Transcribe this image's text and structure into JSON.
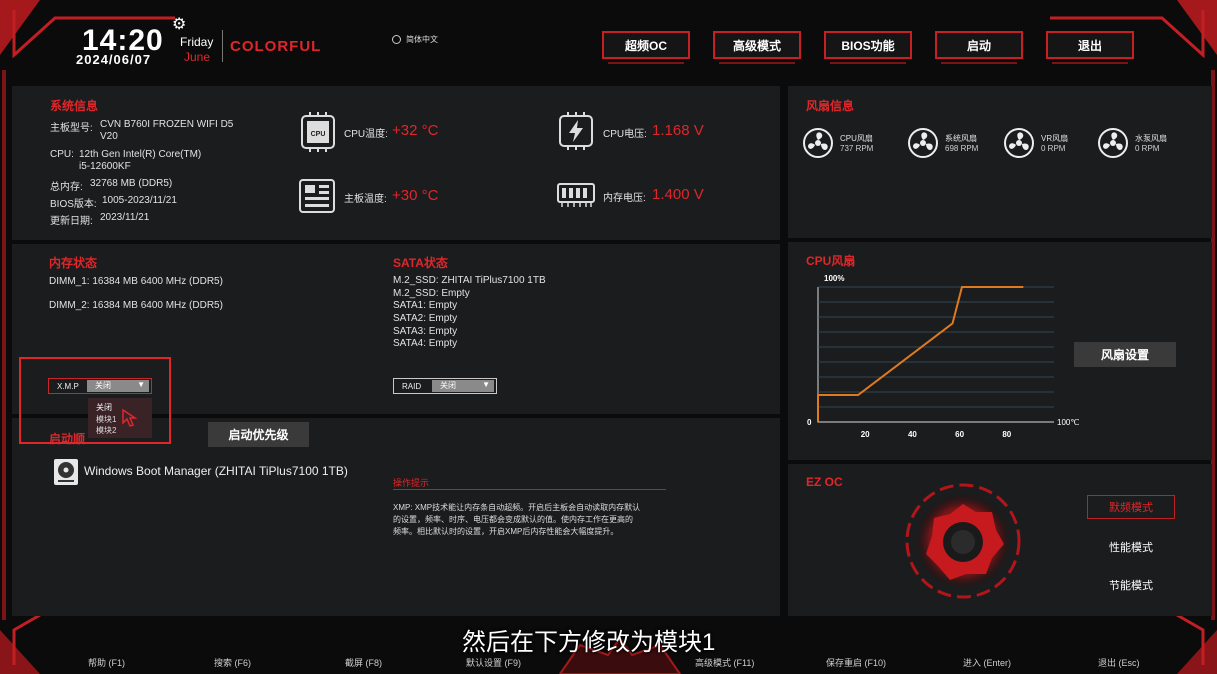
{
  "header": {
    "time": "14:20",
    "day": "Friday",
    "date": "2024/06/07",
    "month": "June",
    "brand": "COLORFUL",
    "language": "简体中文",
    "nav": [
      {
        "label": "超频OC"
      },
      {
        "label": "高级模式"
      },
      {
        "label": "BIOS功能"
      },
      {
        "label": "启动"
      },
      {
        "label": "退出"
      }
    ]
  },
  "system_info": {
    "title": "系统信息",
    "board_label": "主板型号:",
    "board_value_line1": "CVN B760I FROZEN WIFI D5",
    "board_value_line2": "V20",
    "cpu_label": "CPU:",
    "cpu_value_line1": "12th Gen Intel(R) Core(TM)",
    "cpu_value_line2": "i5-12600KF",
    "memory_label": "总内存:",
    "memory_value": "32768 MB (DDR5)",
    "bios_label": "BIOS版本:",
    "bios_value": "1005-2023/11/21",
    "update_label": "更新日期:",
    "update_value": "2023/11/21"
  },
  "metrics": {
    "cpu_icon_text": "CPU",
    "cpu_temp_label": "CPU温度:",
    "cpu_temp_value": "+32 °C",
    "board_temp_label": "主板温度:",
    "board_temp_value": "+30 °C",
    "cpu_voltage_label": "CPU电压:",
    "cpu_voltage_value": "1.168 V",
    "mem_voltage_label": "内存电压:",
    "mem_voltage_value": "1.400 V"
  },
  "fan_info": {
    "title": "风扇信息",
    "fans": [
      {
        "name": "CPU风扇",
        "rpm": "737 RPM"
      },
      {
        "name": "系统风扇",
        "rpm": "698 RPM"
      },
      {
        "name": "VR风扇",
        "rpm": "0 RPM"
      },
      {
        "name": "水泵风扇",
        "rpm": "0 RPM"
      }
    ]
  },
  "memory_status": {
    "title": "内存状态",
    "dimm1": "DIMM_1: 16384 MB  6400 MHz (DDR5)",
    "dimm2": "DIMM_2: 16384 MB  6400 MHz (DDR5)",
    "xmp_label": "X.M.P",
    "xmp_value": "关闭",
    "xmp_options": [
      "关闭",
      "模块1",
      "模块2"
    ]
  },
  "sata_status": {
    "title": "SATA状态",
    "lines": [
      "M.2_SSD: ZHITAI TiPlus7100 1TB",
      "M.2_SSD: Empty",
      "SATA1: Empty",
      "SATA2: Empty",
      "SATA3: Empty",
      "SATA4: Empty"
    ],
    "raid_label": "RAID",
    "raid_value": "关闭"
  },
  "boot": {
    "title": "启动顺",
    "priority_button": "启动优先级",
    "item": "Windows Boot Manager (ZHITAI TiPlus7100 1TB)"
  },
  "tips": {
    "title": "操作提示",
    "line1": "XMP: XMP技术能让内存条自动超频。开启后主板会自动读取内存默认",
    "line2": "的设置，频率、时序、电压都会变成默认的值。使内存工作在更高的",
    "line3": "频率。相比默认时的设置，开启XMP后内存性能会大幅度提升。"
  },
  "cpu_fan_chart": {
    "title": "CPU风扇",
    "fan_settings_button": "风扇设置"
  },
  "chart_data": {
    "type": "line",
    "title": "CPU风扇",
    "xlabel": "100℃",
    "ylabel": "100%",
    "xlim": [
      0,
      100
    ],
    "ylim": [
      0,
      100
    ],
    "x_ticks": [
      "20",
      "40",
      "60",
      "80"
    ],
    "y_min_label": "0",
    "line_color": "#e07a1f",
    "grid": true,
    "points": [
      [
        0,
        0
      ],
      [
        0,
        20
      ],
      [
        17,
        20
      ],
      [
        57,
        73
      ],
      [
        61,
        100
      ],
      [
        87,
        100
      ]
    ]
  },
  "ez_oc": {
    "title": "EZ OC",
    "modes": [
      "默频模式",
      "性能模式",
      "节能模式"
    ]
  },
  "subtitle": "然后在下方修改为模块1",
  "footer": [
    "帮助 (F1)",
    "搜索 (F6)",
    "截屏 (F8)",
    "默认设置 (F9)",
    "高级模式 (F11)",
    "保存重启 (F10)",
    "进入 (Enter)",
    "退出 (Esc)"
  ],
  "colors": {
    "accent": "#e0262a",
    "chart_line": "#e07a1f"
  }
}
